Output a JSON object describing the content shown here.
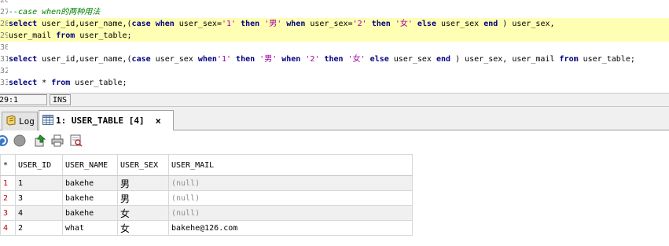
{
  "editor": {
    "lines": [
      {
        "num": "26",
        "highlight": false,
        "tokens": []
      },
      {
        "num": "27",
        "highlight": false,
        "tokens": [
          {
            "t": "--case when的两种用法",
            "c": "cmt"
          }
        ]
      },
      {
        "num": "28",
        "highlight": true,
        "tokens": [
          {
            "t": "select",
            "c": "kw"
          },
          {
            "t": " user_id,user_name,(",
            "c": "plain"
          },
          {
            "t": "case",
            "c": "kw"
          },
          {
            "t": " ",
            "c": "plain"
          },
          {
            "t": "when",
            "c": "kw"
          },
          {
            "t": " user_sex=",
            "c": "plain"
          },
          {
            "t": "'1'",
            "c": "str"
          },
          {
            "t": " ",
            "c": "plain"
          },
          {
            "t": "then",
            "c": "kw"
          },
          {
            "t": " ",
            "c": "plain"
          },
          {
            "t": "'男'",
            "c": "str"
          },
          {
            "t": " ",
            "c": "plain"
          },
          {
            "t": "when",
            "c": "kw"
          },
          {
            "t": " user_sex=",
            "c": "plain"
          },
          {
            "t": "'2'",
            "c": "str"
          },
          {
            "t": " ",
            "c": "plain"
          },
          {
            "t": "then",
            "c": "kw"
          },
          {
            "t": " ",
            "c": "plain"
          },
          {
            "t": "'女'",
            "c": "str"
          },
          {
            "t": " ",
            "c": "plain"
          },
          {
            "t": "else",
            "c": "kw"
          },
          {
            "t": " user_sex ",
            "c": "plain"
          },
          {
            "t": "end",
            "c": "kw"
          },
          {
            "t": " ) user_sex,",
            "c": "plain"
          }
        ]
      },
      {
        "num": "29",
        "highlight": true,
        "tokens": [
          {
            "t": "user_mail ",
            "c": "plain"
          },
          {
            "t": "from",
            "c": "kw"
          },
          {
            "t": " user_table;",
            "c": "plain"
          }
        ]
      },
      {
        "num": "30",
        "highlight": false,
        "tokens": []
      },
      {
        "num": "31",
        "highlight": false,
        "tokens": [
          {
            "t": "select",
            "c": "kw"
          },
          {
            "t": " user_id,user_name,(",
            "c": "plain"
          },
          {
            "t": "case",
            "c": "kw"
          },
          {
            "t": " user_sex ",
            "c": "plain"
          },
          {
            "t": "when",
            "c": "kw"
          },
          {
            "t": "'1'",
            "c": "str"
          },
          {
            "t": " ",
            "c": "plain"
          },
          {
            "t": "then",
            "c": "kw"
          },
          {
            "t": " ",
            "c": "plain"
          },
          {
            "t": "'男'",
            "c": "str"
          },
          {
            "t": " ",
            "c": "plain"
          },
          {
            "t": "when",
            "c": "kw"
          },
          {
            "t": " ",
            "c": "plain"
          },
          {
            "t": "'2'",
            "c": "str"
          },
          {
            "t": " ",
            "c": "plain"
          },
          {
            "t": "then",
            "c": "kw"
          },
          {
            "t": " ",
            "c": "plain"
          },
          {
            "t": "'女'",
            "c": "str"
          },
          {
            "t": " ",
            "c": "plain"
          },
          {
            "t": "else",
            "c": "kw"
          },
          {
            "t": " user_sex ",
            "c": "plain"
          },
          {
            "t": "end",
            "c": "kw"
          },
          {
            "t": " ) user_sex, user_mail ",
            "c": "plain"
          },
          {
            "t": "from",
            "c": "kw"
          },
          {
            "t": " user_table;",
            "c": "plain"
          }
        ]
      },
      {
        "num": "32",
        "highlight": false,
        "tokens": []
      },
      {
        "num": "33",
        "highlight": false,
        "tokens": [
          {
            "t": "select",
            "c": "kw"
          },
          {
            "t": " * ",
            "c": "plain"
          },
          {
            "t": "from",
            "c": "kw"
          },
          {
            "t": " user_table;",
            "c": "plain"
          }
        ]
      }
    ]
  },
  "status": {
    "position": "29:1 [1229]",
    "mode": "INS"
  },
  "tabs": {
    "log_label": "Log",
    "result_label": "1: USER_TABLE [4]",
    "close_symbol": "×"
  },
  "toolbar": {
    "icons": [
      "refresh-icon",
      "stop-icon",
      "export-icon",
      "print-icon",
      "query-by-example-icon"
    ]
  },
  "grid": {
    "corner": "*",
    "columns": [
      "USER_ID",
      "USER_NAME",
      "USER_SEX",
      "USER_MAIL"
    ],
    "rows": [
      {
        "num": "1",
        "cells": [
          "1",
          "bakehe",
          "男",
          "(null)"
        ],
        "nulls": [
          false,
          false,
          false,
          true
        ]
      },
      {
        "num": "2",
        "cells": [
          "3",
          "bakehe",
          "男",
          "(null)"
        ],
        "nulls": [
          false,
          false,
          false,
          true
        ]
      },
      {
        "num": "3",
        "cells": [
          "4",
          "bakehe",
          "女",
          "(null)"
        ],
        "nulls": [
          false,
          false,
          false,
          true
        ]
      },
      {
        "num": "4",
        "cells": [
          "2",
          "what",
          "女",
          "bakehe@126.com"
        ],
        "nulls": [
          false,
          false,
          false,
          false
        ]
      }
    ]
  },
  "colors": {
    "keyword": "#000080",
    "string": "#a000a0",
    "comment": "#008000",
    "highlight": "#ffffb4",
    "row_number": "#c00000",
    "null": "#909090"
  }
}
